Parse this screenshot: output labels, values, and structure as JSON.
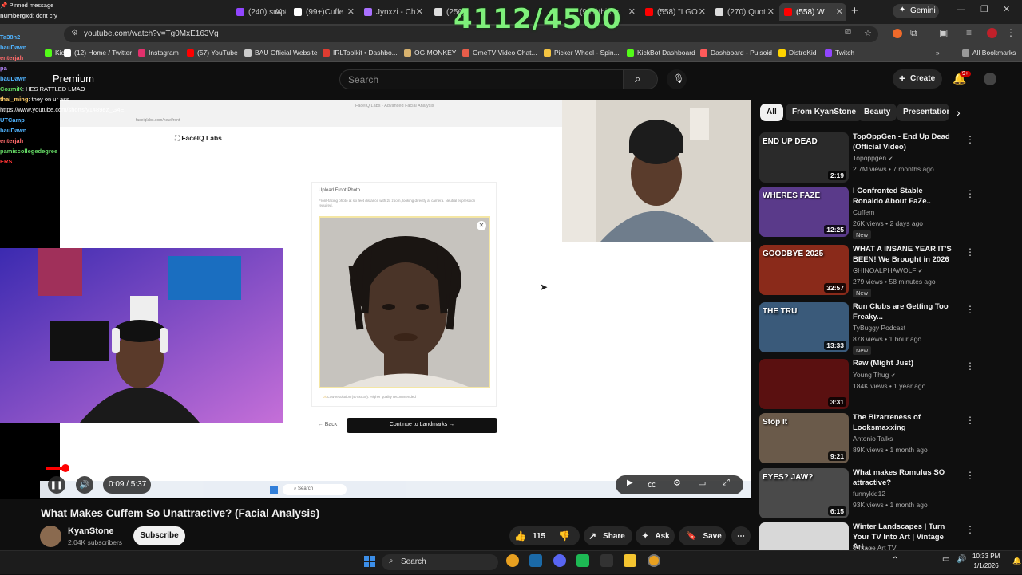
{
  "browser": {
    "tabs": [
      {
        "label": "(240) ѕιмρℓ",
        "color": "#9146ff"
      },
      {
        "label": "(99+)Cuffe",
        "color": "#ffffff"
      },
      {
        "label": "Jynxzi - Ch",
        "color": "#a970ff"
      },
      {
        "label": "(256)",
        "color": "#ffffff"
      },
      {
        "label": "(66)",
        "color": "#ffffff"
      },
      {
        "label": "(99+)this is",
        "color": "#ffffff"
      },
      {
        "label": "(558) \"I GO",
        "color": "#ff0000"
      },
      {
        "label": "(270) Quot",
        "color": "#ffffff"
      },
      {
        "label": "(558) W",
        "color": "#ff0000"
      }
    ],
    "new_tab": "+",
    "gemini_label": "Gemini",
    "url": "youtube.com/watch?v=Tg0MxE163Vg",
    "bookmarks": [
      {
        "label": "Kick",
        "color": "#53fc18"
      },
      {
        "label": "(12) Home / Twitter",
        "color": "#ffffff"
      },
      {
        "label": "Instagram",
        "color": "#e1306c"
      },
      {
        "label": "(57) YouTube",
        "color": "#ff0000"
      },
      {
        "label": "BAU Official Website",
        "color": "#cccccc"
      },
      {
        "label": "IRLToolkit • Dashbo...",
        "color": "#e03c31"
      },
      {
        "label": "OG MONKEY",
        "color": "#d8b26e"
      },
      {
        "label": "OmeTV Video Chat...",
        "color": "#e85d4a"
      },
      {
        "label": "Picker Wheel - Spin...",
        "color": "#f5c542"
      },
      {
        "label": "KickBot Dashboard",
        "color": "#53fc18"
      },
      {
        "label": "Dashboard - Pulsoid",
        "color": "#ff5a5a"
      },
      {
        "label": "DistroKid",
        "color": "#ffd400"
      },
      {
        "label": "Twitch",
        "color": "#9146ff"
      }
    ],
    "all_bookmarks": "All Bookmarks"
  },
  "youtube": {
    "logo_text": "Premium",
    "search_placeholder": "Search",
    "create_label": "Create",
    "notif_count": "9+",
    "chips": [
      "All",
      "From KyanStone",
      "Beauty",
      "Presentation"
    ],
    "video": {
      "title": "What Makes Cuffem So Unattractive? (Facial Analysis)",
      "time": "0:09 / 5:37",
      "progress": 0.027,
      "channel": "KyanStone",
      "subscribers": "2.04K subscribers",
      "subscribe_label": "Subscribe",
      "likes": "115",
      "share_label": "Share",
      "ask_label": "Ask",
      "save_label": "Save"
    },
    "recommended": [
      {
        "title": "TopOppGen - End Up Dead (Official Video)",
        "channel": "Topoppgen",
        "verified": true,
        "meta": "2.7M views • 7 months ago",
        "duration": "2:19",
        "new": "",
        "thumb": "#2a2a2a",
        "thumb_text": "END UP DEAD"
      },
      {
        "title": "I Confronted Stable Ronaldo About FaZe..",
        "channel": "Cuffem",
        "verified": false,
        "meta": "26K views • 2 days ago",
        "duration": "12:25",
        "new": "New",
        "thumb": "#5a3a8a",
        "thumb_text": "WHERES FAZE"
      },
      {
        "title": "WHAT A INSANE YEAR IT'S BEEN! We Brought in 2026 ...",
        "channel": "CHINOALPHAWOLF",
        "verified": true,
        "meta": "279 views • 58 minutes ago",
        "duration": "32:57",
        "new": "New",
        "thumb": "#8a2a1a",
        "thumb_text": "GOODBYE 2025"
      },
      {
        "title": "Run Clubs are Getting Too Freaky...",
        "channel": "TyBuggy Podcast",
        "verified": false,
        "meta": "878 views • 1 hour ago",
        "duration": "13:33",
        "new": "New",
        "thumb": "#3a5a7a",
        "thumb_text": "THE TRU"
      },
      {
        "title": "Raw (Might Just)",
        "channel": "Young Thug",
        "verified": true,
        "meta": "184K views • 1 year ago",
        "duration": "3:31",
        "new": "",
        "thumb": "#5a1010",
        "thumb_text": ""
      },
      {
        "title": "The Bizarreness of Looksmaxxing",
        "channel": "Antonio Talks",
        "verified": false,
        "meta": "89K views • 1 month ago",
        "duration": "9:21",
        "new": "",
        "thumb": "#6a5a4a",
        "thumb_text": "Stop It"
      },
      {
        "title": "What makes Romulus SO attractive?",
        "channel": "funnykid12",
        "verified": false,
        "meta": "93K views • 1 month ago",
        "duration": "6:15",
        "new": "",
        "thumb": "#4a4a4a",
        "thumb_text": "EYES? JAW?"
      },
      {
        "title": "Winter Landscapes | Turn Your TV Into Art | Vintage Art ...",
        "channel": "Vintage Art TV",
        "verified": false,
        "meta": "",
        "duration": "",
        "new": "",
        "thumb": "#d8d8d8",
        "thumb_text": ""
      }
    ]
  },
  "stream_overlay": {
    "counter": "4112/4500",
    "pinned_label": "Pinned message",
    "chat": [
      {
        "user": "numbergxd",
        "msg": "dont cry",
        "color": "#d8d8d8"
      },
      {
        "user": "Ta38h2",
        "msg": "",
        "color": "#50b4ff"
      },
      {
        "user": "bauDawn",
        "msg": "",
        "color": "#50b4ff"
      },
      {
        "user": "enterjah",
        "msg": "",
        "color": "#ff6a6a"
      },
      {
        "user": "pa",
        "msg": "",
        "color": "#b888ff"
      },
      {
        "user": "bauDawn",
        "msg": "",
        "color": "#50b4ff"
      },
      {
        "user": "CozmiK",
        "msg": "HES RATTLED LMAO",
        "color": "#66dd66"
      },
      {
        "user": "thai_ming",
        "msg": "they on ur ass",
        "color": "#ffcc66"
      },
      {
        "user": "",
        "msg": "https://www.youtube.com/shorts/y1489ez_G4E",
        "color": "#ffffff"
      },
      {
        "user": "UTCamp",
        "msg": "",
        "color": "#50b4ff"
      },
      {
        "user": "bauDawn",
        "msg": "",
        "color": "#50b4ff"
      },
      {
        "user": "enterjah",
        "msg": "",
        "color": "#ff6a6a"
      },
      {
        "user": "pamiscollegedegree",
        "msg": "",
        "color": "#66dd66"
      },
      {
        "user": "",
        "msg": "ERS",
        "color": "#ff3333"
      }
    ]
  },
  "faceiq": {
    "tab_title": "FaceIQ Labs - Advanced Facial Analysis",
    "url": "faceiqlabs.com/new/front",
    "brand": "FaceIQ Labs",
    "card_title": "Upload Front Photo",
    "card_desc": "Front-facing photo at six feet distance with 2x zoom, looking directly at camera. Neutral expression required.",
    "warning": "Low resolution (478x530). Higher quality recommended",
    "back_label": "Back",
    "continue_label": "Continue to Landmarks →"
  },
  "windows": {
    "search_label": "Search",
    "time": "10:33 PM",
    "date": "1/1/2026"
  }
}
